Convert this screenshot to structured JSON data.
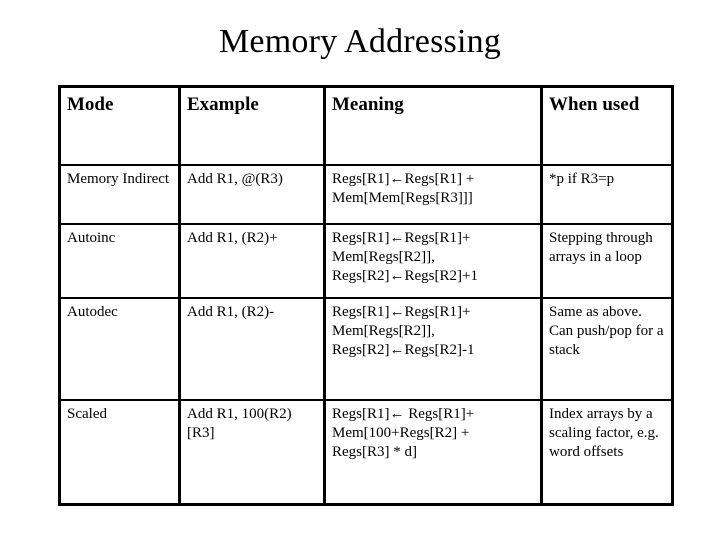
{
  "slide": {
    "title": "Memory Addressing"
  },
  "table": {
    "headers": [
      "Mode",
      "Example",
      "Meaning",
      "When used"
    ],
    "rows": [
      {
        "mode": "Memory Indirect",
        "example": "Add R1, @(R3)",
        "meaning_lines": [
          "Regs[R1]←Regs[R1] +",
          "Mem[Mem[Regs[R3]]]"
        ],
        "when_used": "*p if R3=p"
      },
      {
        "mode": "Autoinc",
        "example": "Add R1, (R2)+",
        "meaning_lines": [
          "Regs[R1]←Regs[R1]+",
          "Mem[Regs[R2]],",
          "Regs[R2]←Regs[R2]+1"
        ],
        "when_used": "Stepping through arrays in a loop"
      },
      {
        "mode": "Autodec",
        "example": "Add R1, (R2)-",
        "meaning_lines": [
          "Regs[R1]←Regs[R1]+",
          "Mem[Regs[R2]],",
          "Regs[R2]←Regs[R2]-1"
        ],
        "when_used": "Same as above. Can push/pop for a stack"
      },
      {
        "mode": "Scaled",
        "example": "Add R1, 100(R2)[R3]",
        "meaning_lines": [
          "Regs[R1]← Regs[R1]+",
          "Mem[100+Regs[R2] +",
          "Regs[R3] * d]"
        ],
        "when_used": "Index arrays by a scaling factor, e.g. word offsets"
      }
    ]
  },
  "colors": {
    "background": "#ffffff",
    "text": "#000000",
    "border": "#000000"
  }
}
